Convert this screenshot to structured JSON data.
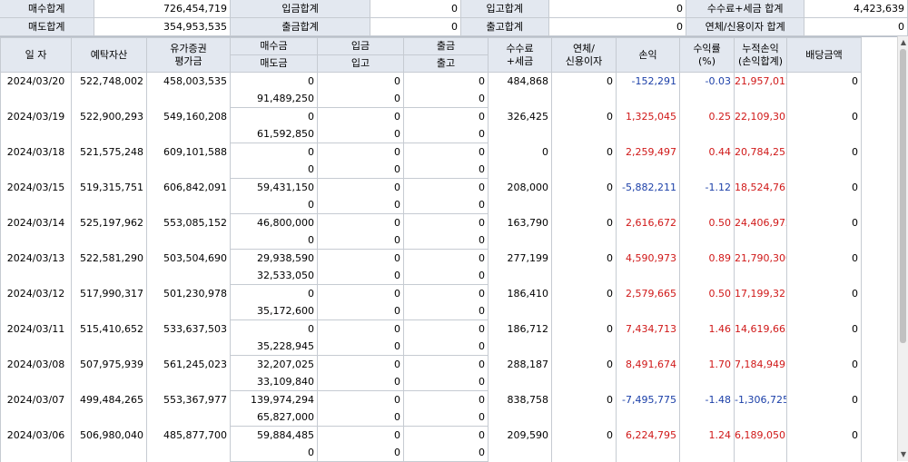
{
  "summary": {
    "rows": [
      [
        {
          "label": "매수합계",
          "value": "726,454,719"
        },
        {
          "label": "입금합계",
          "value": "0"
        },
        {
          "label": "입고합계",
          "value": "0"
        },
        {
          "label": "수수료+세금 합계",
          "value": "4,423,639"
        }
      ],
      [
        {
          "label": "매도합계",
          "value": "354,953,535"
        },
        {
          "label": "출금합계",
          "value": "0"
        },
        {
          "label": "출고합계",
          "value": "0"
        },
        {
          "label": "연체/신용이자 합계",
          "value": "0"
        }
      ]
    ]
  },
  "table": {
    "headers": {
      "date": "일 자",
      "deposit_assets": "예탁자산",
      "securities_eval": "유가증권\n평가금",
      "buy_amount": "매수금",
      "sell_amount": "매도금",
      "deposit_in": "입금",
      "stock_in": "입고",
      "withdraw_out": "출금",
      "stock_out": "출고",
      "fee_tax": "수수료\n+세금",
      "overdue_interest": "연체/\n신용이자",
      "profit_loss": "손익",
      "return_rate": "수익률\n(%)",
      "cumulative_pl": "누적손익\n(손익합계)",
      "dividend": "배당금액"
    },
    "rows": [
      {
        "date": "2024/03/20",
        "deposit_assets": "522,748,002",
        "securities_eval": "458,003,535",
        "buy": "0",
        "sell": "91,489,250",
        "dep": "0",
        "stin": "0",
        "wd": "0",
        "stout": "0",
        "fee": "484,868",
        "interest": "0",
        "pl": "-152,291",
        "rate": "-0.03",
        "cum": "21,957,012",
        "div": "0",
        "pl_sign": "neg",
        "rate_sign": "neg",
        "cum_sign": "pos"
      },
      {
        "date": "2024/03/19",
        "deposit_assets": "522,900,293",
        "securities_eval": "549,160,208",
        "buy": "0",
        "sell": "61,592,850",
        "dep": "0",
        "stin": "0",
        "wd": "0",
        "stout": "0",
        "fee": "326,425",
        "interest": "0",
        "pl": "1,325,045",
        "rate": "0.25",
        "cum": "22,109,303",
        "div": "0",
        "pl_sign": "pos",
        "rate_sign": "pos",
        "cum_sign": "pos"
      },
      {
        "date": "2024/03/18",
        "deposit_assets": "521,575,248",
        "securities_eval": "609,101,588",
        "buy": "0",
        "sell": "0",
        "dep": "0",
        "stin": "0",
        "wd": "0",
        "stout": "0",
        "fee": "0",
        "interest": "0",
        "pl": "2,259,497",
        "rate": "0.44",
        "cum": "20,784,258",
        "div": "0",
        "pl_sign": "pos",
        "rate_sign": "pos",
        "cum_sign": "pos"
      },
      {
        "date": "2024/03/15",
        "deposit_assets": "519,315,751",
        "securities_eval": "606,842,091",
        "buy": "59,431,150",
        "sell": "0",
        "dep": "0",
        "stin": "0",
        "wd": "0",
        "stout": "0",
        "fee": "208,000",
        "interest": "0",
        "pl": "-5,882,211",
        "rate": "-1.12",
        "cum": "18,524,761",
        "div": "0",
        "pl_sign": "neg",
        "rate_sign": "neg",
        "cum_sign": "pos"
      },
      {
        "date": "2024/03/14",
        "deposit_assets": "525,197,962",
        "securities_eval": "553,085,152",
        "buy": "46,800,000",
        "sell": "0",
        "dep": "0",
        "stin": "0",
        "wd": "0",
        "stout": "0",
        "fee": "163,790",
        "interest": "0",
        "pl": "2,616,672",
        "rate": "0.50",
        "cum": "24,406,972",
        "div": "0",
        "pl_sign": "pos",
        "rate_sign": "pos",
        "cum_sign": "pos"
      },
      {
        "date": "2024/03/13",
        "deposit_assets": "522,581,290",
        "securities_eval": "503,504,690",
        "buy": "29,938,590",
        "sell": "32,533,050",
        "dep": "0",
        "stin": "0",
        "wd": "0",
        "stout": "0",
        "fee": "277,199",
        "interest": "0",
        "pl": "4,590,973",
        "rate": "0.89",
        "cum": "21,790,300",
        "div": "0",
        "pl_sign": "pos",
        "rate_sign": "pos",
        "cum_sign": "pos"
      },
      {
        "date": "2024/03/12",
        "deposit_assets": "517,990,317",
        "securities_eval": "501,230,978",
        "buy": "0",
        "sell": "35,172,600",
        "dep": "0",
        "stin": "0",
        "wd": "0",
        "stout": "0",
        "fee": "186,410",
        "interest": "0",
        "pl": "2,579,665",
        "rate": "0.50",
        "cum": "17,199,327",
        "div": "0",
        "pl_sign": "pos",
        "rate_sign": "pos",
        "cum_sign": "pos"
      },
      {
        "date": "2024/03/11",
        "deposit_assets": "515,410,652",
        "securities_eval": "533,637,503",
        "buy": "0",
        "sell": "35,228,945",
        "dep": "0",
        "stin": "0",
        "wd": "0",
        "stout": "0",
        "fee": "186,712",
        "interest": "0",
        "pl": "7,434,713",
        "rate": "1.46",
        "cum": "14,619,662",
        "div": "0",
        "pl_sign": "pos",
        "rate_sign": "pos",
        "cum_sign": "pos"
      },
      {
        "date": "2024/03/08",
        "deposit_assets": "507,975,939",
        "securities_eval": "561,245,023",
        "buy": "32,207,025",
        "sell": "33,109,840",
        "dep": "0",
        "stin": "0",
        "wd": "0",
        "stout": "0",
        "fee": "288,187",
        "interest": "0",
        "pl": "8,491,674",
        "rate": "1.70",
        "cum": "7,184,949",
        "div": "0",
        "pl_sign": "pos",
        "rate_sign": "pos",
        "cum_sign": "pos"
      },
      {
        "date": "2024/03/07",
        "deposit_assets": "499,484,265",
        "securities_eval": "553,367,977",
        "buy": "139,974,294",
        "sell": "65,827,000",
        "dep": "0",
        "stin": "0",
        "wd": "0",
        "stout": "0",
        "fee": "838,758",
        "interest": "0",
        "pl": "-7,495,775",
        "rate": "-1.48",
        "cum": "-1,306,725",
        "div": "0",
        "pl_sign": "neg",
        "rate_sign": "neg",
        "cum_sign": "neg"
      },
      {
        "date": "2024/03/06",
        "deposit_assets": "506,980,040",
        "securities_eval": "485,877,700",
        "buy": "59,884,485",
        "sell": "0",
        "dep": "0",
        "stin": "0",
        "wd": "0",
        "stout": "0",
        "fee": "209,590",
        "interest": "0",
        "pl": "6,224,795",
        "rate": "1.24",
        "cum": "6,189,050",
        "div": "0",
        "pl_sign": "pos",
        "rate_sign": "pos",
        "cum_sign": "pos"
      }
    ]
  },
  "scrollbar": {
    "up_icon": "triangle-up-icon",
    "down_icon": "triangle-down-icon"
  },
  "colors": {
    "positive": "#d01818",
    "negative": "#1b3fa8",
    "header_bg": "#e3e8f0"
  }
}
